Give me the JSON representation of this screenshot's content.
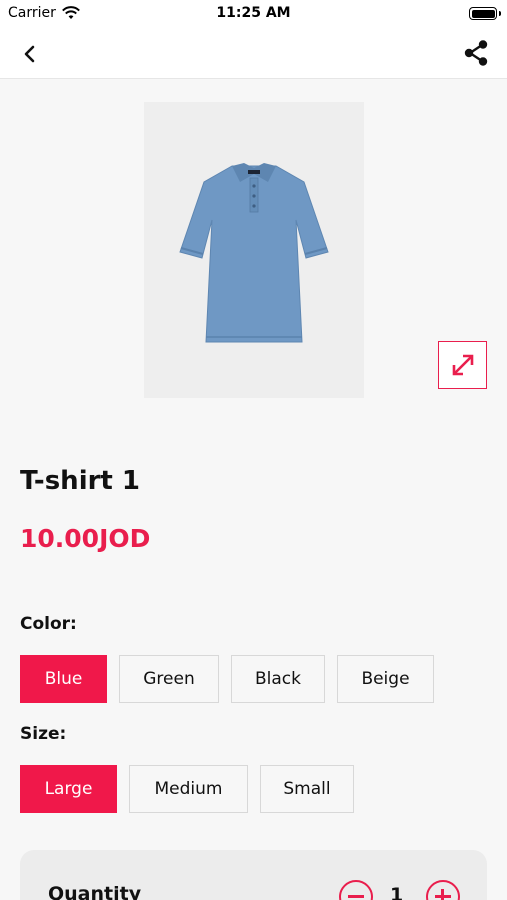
{
  "status_bar": {
    "carrier": "Carrier",
    "time": "11:25 AM"
  },
  "nav": {
    "back_icon": "chevron-left-icon",
    "share_icon": "share-icon"
  },
  "product": {
    "title": "T-shirt 1",
    "price": "10.00JOD",
    "image_icon": "polo-shirt-image",
    "expand_icon": "expand-arrows-icon"
  },
  "color": {
    "label": "Color:",
    "options": [
      "Blue",
      "Green",
      "Black",
      "Beige"
    ],
    "selected": "Blue"
  },
  "size": {
    "label": "Size:",
    "options": [
      "Large",
      "Medium",
      "Small"
    ],
    "selected": "Large"
  },
  "quantity": {
    "label": "Quantity",
    "value": "1"
  },
  "colors": {
    "accent": "#f0184a",
    "background": "#f7f7f7",
    "shirt": "#6f98c4"
  }
}
